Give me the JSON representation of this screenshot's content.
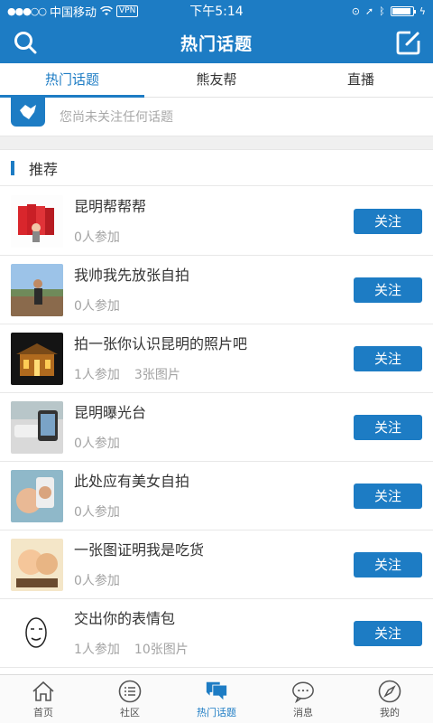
{
  "status_bar": {
    "carrier": "中国移动",
    "vpn": "VPN",
    "time": "下午5:14",
    "battery_level": 0.9
  },
  "navbar": {
    "title": "热门话题",
    "left_icon": "search-icon",
    "right_icon": "compose-icon"
  },
  "tabs": [
    {
      "label": "热门话题",
      "active": true
    },
    {
      "label": "熊友帮",
      "active": false
    },
    {
      "label": "直播",
      "active": false
    }
  ],
  "notice": {
    "text": "您尚未关注任何话题"
  },
  "section": {
    "title": "推荐"
  },
  "topics": [
    {
      "name": "昆明帮帮帮",
      "participants": "0人参加",
      "images": "",
      "button": "关注"
    },
    {
      "name": "我帅我先放张自拍",
      "participants": "0人参加",
      "images": "",
      "button": "关注"
    },
    {
      "name": "拍一张你认识昆明的照片吧",
      "participants": "1人参加",
      "images": "3张图片",
      "button": "关注"
    },
    {
      "name": "昆明曝光台",
      "participants": "0人参加",
      "images": "",
      "button": "关注"
    },
    {
      "name": "此处应有美女自拍",
      "participants": "0人参加",
      "images": "",
      "button": "关注"
    },
    {
      "name": "一张图证明我是吃货",
      "participants": "0人参加",
      "images": "",
      "button": "关注"
    },
    {
      "name": "交出你的表情包",
      "participants": "1人参加",
      "images": "10张图片",
      "button": "关注"
    }
  ],
  "bottom_nav": [
    {
      "label": "首页",
      "icon": "home-icon",
      "active": false
    },
    {
      "label": "社区",
      "icon": "list-icon",
      "active": false
    },
    {
      "label": "热门话题",
      "icon": "chat-bubbles-icon",
      "active": true
    },
    {
      "label": "消息",
      "icon": "message-icon",
      "active": false
    },
    {
      "label": "我的",
      "icon": "compass-icon",
      "active": false
    }
  ],
  "colors": {
    "primary": "#1d7cc4",
    "muted": "#a3a3a3"
  }
}
